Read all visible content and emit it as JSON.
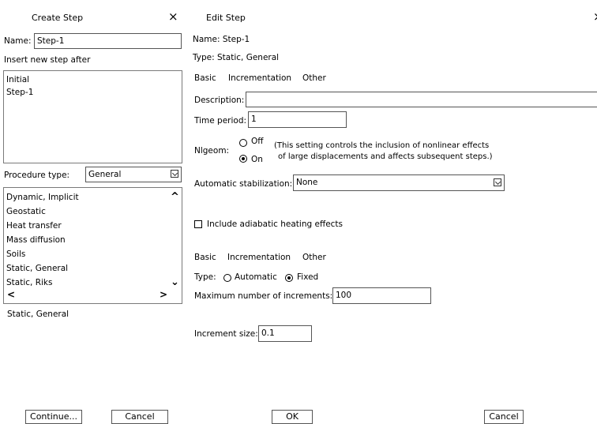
{
  "create_step": {
    "title": "Create Step",
    "close_glyph": "×",
    "name_label": "Name:",
    "name_value": "Step-1",
    "insert_label": "Insert new step after",
    "steps": [
      "Initial",
      "Step-1"
    ],
    "procedure_label": "Procedure type:",
    "procedure_value": "General",
    "procedures": [
      "Dynamic, Implicit",
      "Geostatic",
      "Heat transfer",
      "Mass diffusion",
      "Soils",
      "Static, General",
      "Static, Riks"
    ],
    "scroll_up": "^",
    "scroll_down": "⌄",
    "scroll_left": "<",
    "scroll_right": ">",
    "selected_procedure": "Static, General",
    "continue_button": "Continue...",
    "cancel_button": "Cancel"
  },
  "edit_step": {
    "title": "Edit Step",
    "close_glyph": "×",
    "name_line": "Name:  Step-1",
    "type_line": "Type:  Static, General",
    "tabs_top": [
      "Basic",
      "Incrementation",
      "Other"
    ],
    "description_label": "Description:",
    "description_value": "",
    "time_period_label": "Time period:",
    "time_period_value": "1",
    "nlgeom_label": "Nlgeom:",
    "nlgeom_off": "Off",
    "nlgeom_on": "On",
    "nlgeom_note_1": "(This setting controls the inclusion of nonlinear effects",
    "nlgeom_note_2": "of large displacements and affects subsequent steps.)",
    "stabilization_label": "Automatic stabilization:",
    "stabilization_value": "None",
    "adiabatic_label": "Include adiabatic heating effects",
    "tabs_bottom": [
      "Basic",
      "Incrementation",
      "Other"
    ],
    "type_label": "Type:",
    "type_automatic": "Automatic",
    "type_fixed": "Fixed",
    "max_increments_label": "Maximum number of increments:",
    "max_increments_value": "100",
    "increment_size_label": "Increment size:",
    "increment_size_value": "0.1",
    "ok_button": "OK",
    "cancel_button": "Cancel"
  }
}
